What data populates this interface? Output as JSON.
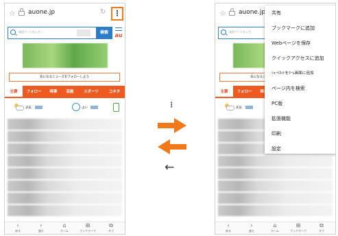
{
  "browser": {
    "url": "auone.jp",
    "menu_glyph": "⋮",
    "reload_glyph": "↻",
    "star_glyph": "☆"
  },
  "search": {
    "placeholder": "検索ワードを入力",
    "button_label": "検索",
    "brand": "au"
  },
  "follow_label": "気になるニュースをフォローしよう",
  "tabs": [
    {
      "label": "主要",
      "active": true
    },
    {
      "label": "フォロー"
    },
    {
      "label": "時事"
    },
    {
      "label": "芸能"
    },
    {
      "label": "スポーツ"
    },
    {
      "label": "コネタ"
    }
  ],
  "info": {
    "weather_label": "天気",
    "fortune_label": "占い"
  },
  "bottom_nav": [
    {
      "glyph": "‹",
      "label": "戻る"
    },
    {
      "glyph": "›",
      "label": "進む"
    },
    {
      "glyph": "⌂",
      "label": "ホーム"
    },
    {
      "glyph": "⊞",
      "label": "ブックマーク"
    },
    {
      "glyph": "⧉",
      "label": "タブ"
    }
  ],
  "center": {
    "menu_glyph": "⋮",
    "back_glyph": "←"
  },
  "menu_items": [
    {
      "label": "共有"
    },
    {
      "label": "ブックマークに追加"
    },
    {
      "label": "Webページを保存"
    },
    {
      "label": "クイックアクセスに追加"
    },
    {
      "label": "ｼｮｰﾄｶｯﾄをﾎｰﾑ画面に追加"
    },
    {
      "label": "ページ内を検索"
    },
    {
      "label": "PC版"
    },
    {
      "label": "拡張機能"
    },
    {
      "label": "印刷"
    },
    {
      "label": "設定"
    }
  ],
  "colors": {
    "accent_orange": "#f07a1a",
    "tab_red": "#ef5a20",
    "search_blue": "#2c7cc8"
  }
}
